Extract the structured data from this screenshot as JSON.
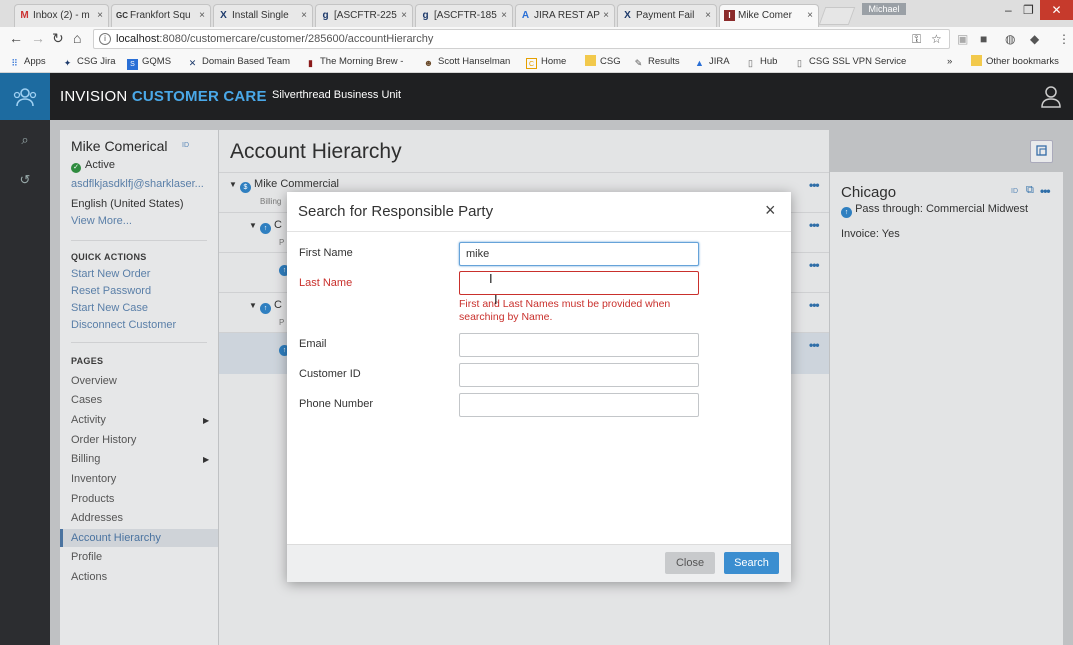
{
  "browser": {
    "tabs": [
      {
        "icon": "M",
        "title": "Inbox (2) - m",
        "active": false
      },
      {
        "icon": "GC",
        "title": "Frankfort Squ",
        "active": false
      },
      {
        "icon": "X",
        "title": "Install Single",
        "active": false
      },
      {
        "icon": "g",
        "title": "[ASCFTR-225",
        "active": false
      },
      {
        "icon": "g",
        "title": "[ASCFTR-185",
        "active": false
      },
      {
        "icon": "A",
        "title": "JIRA REST AP",
        "active": false
      },
      {
        "icon": "X",
        "title": "Payment Fail",
        "active": false
      },
      {
        "icon": "I",
        "title": "Mike Comer",
        "active": true
      }
    ],
    "profile_chip": "Michael",
    "url_host": "localhost",
    "url_rest": ":8080/customercare/customer/285600/accountHierarchy",
    "bookmarks": [
      {
        "icon": "grid-icon",
        "label": "Apps"
      },
      {
        "icon": "jira-icon",
        "label": "CSG Jira"
      },
      {
        "icon": "gqms-icon",
        "label": "GQMS"
      },
      {
        "icon": "x-icon",
        "label": "Domain Based Team"
      },
      {
        "icon": "mug-icon",
        "label": "The Morning Brew -"
      },
      {
        "icon": "person-icon",
        "label": "Scott Hanselman"
      },
      {
        "icon": "c-icon",
        "label": "Home"
      },
      {
        "icon": "folder-icon",
        "label": "CSG"
      },
      {
        "icon": "feather-icon",
        "label": "Results"
      },
      {
        "icon": "atlassian-icon",
        "label": "JIRA"
      },
      {
        "icon": "page-icon",
        "label": "Hub"
      },
      {
        "icon": "page-icon",
        "label": "CSG SSL VPN Service"
      }
    ],
    "more_bookmarks": "»",
    "other_bookmarks": "Other bookmarks"
  },
  "app": {
    "brand_prefix": "INVISION ",
    "brand_suffix": "CUSTOMER CARE",
    "business_unit": "Silverthread Business Unit"
  },
  "customer": {
    "name": "Mike Comerical",
    "id_badge": "ID",
    "status": "Active",
    "email": "asdflkjasdklfj@sharklaser...",
    "language": "English (United States)",
    "view_more": "View More..."
  },
  "quick_actions": {
    "heading": "QUICK ACTIONS",
    "items": [
      "Start New Order",
      "Reset Password",
      "Start New Case",
      "Disconnect Customer"
    ]
  },
  "pages": {
    "heading": "PAGES",
    "items": [
      "Overview",
      "Cases",
      "Activity",
      "Order History",
      "Billing",
      "Inventory",
      "Products",
      "Addresses",
      "Account Hierarchy",
      "Profile",
      "Actions"
    ],
    "selected": "Account Hierarchy"
  },
  "main": {
    "title": "Account Hierarchy",
    "root_account": "Mike Commercial",
    "root_sub": "Billing",
    "child1_label": "C",
    "child1_sub": "P",
    "child2_label": "C",
    "child2_sub": "P",
    "row_menu": "•••"
  },
  "detail": {
    "city": "Chicago",
    "id_badge": "ID",
    "pass_through": "Pass through: Commercial Midwest",
    "invoice": "Invoice: Yes"
  },
  "modal": {
    "title": "Search for Responsible Party",
    "close_glyph": "×",
    "fields": {
      "first_name_label": "First Name",
      "first_name_value": "mike",
      "last_name_label": "Last Name",
      "last_name_value": "",
      "error": "First and Last Names must be provided when searching by Name.",
      "email_label": "Email",
      "email_value": "",
      "customer_id_label": "Customer ID",
      "customer_id_value": "",
      "phone_label": "Phone Number",
      "phone_value": ""
    },
    "close_button": "Close",
    "search_button": "Search"
  },
  "colors": {
    "accent": "#3b8ed0",
    "brand": "#4aa8e8",
    "error": "#c9302c",
    "active": "#2e8b3e",
    "header": "#1f2022"
  }
}
